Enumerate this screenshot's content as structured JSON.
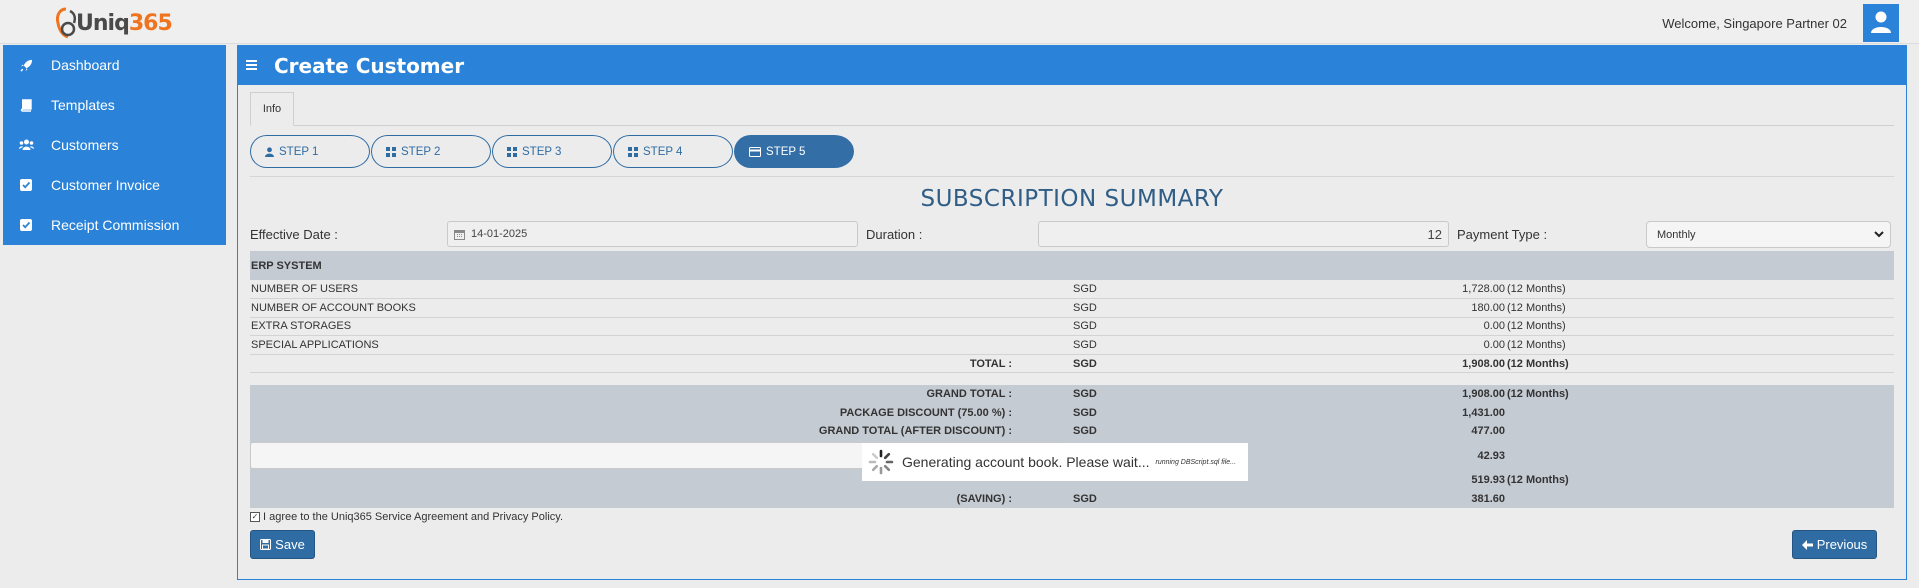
{
  "header": {
    "logo_text_a": "Uniq",
    "logo_text_b": "365",
    "welcome": "Welcome, Singapore Partner 02"
  },
  "sidebar": {
    "items": [
      {
        "label": "Dashboard",
        "icon": "rocket-icon"
      },
      {
        "label": "Templates",
        "icon": "book-icon"
      },
      {
        "label": "Customers",
        "icon": "users-icon"
      },
      {
        "label": "Customer Invoice",
        "icon": "check-square-icon"
      },
      {
        "label": "Receipt Commission",
        "icon": "check-square-icon"
      }
    ]
  },
  "page": {
    "title": "Create Customer",
    "info_tab": "Info",
    "steps": [
      {
        "label": "STEP 1",
        "icon": "user-icon",
        "active": false
      },
      {
        "label": "STEP 2",
        "icon": "grid-icon",
        "active": false
      },
      {
        "label": "STEP 3",
        "icon": "grid-icon",
        "active": false
      },
      {
        "label": "STEP 4",
        "icon": "grid-icon",
        "active": false
      },
      {
        "label": "STEP 5",
        "icon": "credit-card-icon",
        "active": true
      }
    ]
  },
  "summary": {
    "title": "SUBSCRIPTION SUMMARY",
    "effective_date_label": "Effective Date :",
    "effective_date_value": "14-01-2025",
    "duration_label": "Duration :",
    "duration_value": "12",
    "payment_type_label": "Payment Type :",
    "payment_type_value": "Monthly",
    "section_header": "ERP SYSTEM",
    "currency": "SGD",
    "lines": [
      {
        "label": "NUMBER OF USERS",
        "amount": "1,728.00",
        "period": "(12 Months)"
      },
      {
        "label": "NUMBER OF ACCOUNT BOOKS",
        "amount": "180.00",
        "period": "(12 Months)"
      },
      {
        "label": "EXTRA STORAGES",
        "amount": "0.00",
        "period": "(12 Months)"
      },
      {
        "label": "SPECIAL APPLICATIONS",
        "amount": "0.00",
        "period": "(12 Months)"
      }
    ],
    "total_label": "TOTAL :",
    "total_amount": "1,908.00",
    "total_period": "(12 Months)",
    "grand_total_label": "GRAND TOTAL :",
    "grand_total_amount": "1,908.00",
    "grand_total_period": "(12 Months)",
    "package_discount_label": "PACKAGE DISCOUNT (75.00 %) :",
    "package_discount_amount": "1,431.00",
    "grand_after_label": "GRAND TOTAL (AFTER DISCOUNT) :",
    "grand_after_amount": "477.00",
    "row_x_amount": "42.93",
    "row_y_amount": "519.93",
    "row_y_period": "(12 Months)",
    "saving_label": "(SAVING) :",
    "saving_amount": "381.60"
  },
  "footer": {
    "agree_text": "I agree to the Uniq365 Service Agreement and Privacy Policy.",
    "save_label": "Save",
    "previous_label": "Previous"
  },
  "overlay": {
    "message": "Generating account book. Please wait...",
    "submessage": "running DBScript.sql file..."
  },
  "colors": {
    "primary": "#2a83d8",
    "step_active": "#336fa6",
    "table_header": "#c5cbd3",
    "brand_orange": "#f0731e"
  }
}
